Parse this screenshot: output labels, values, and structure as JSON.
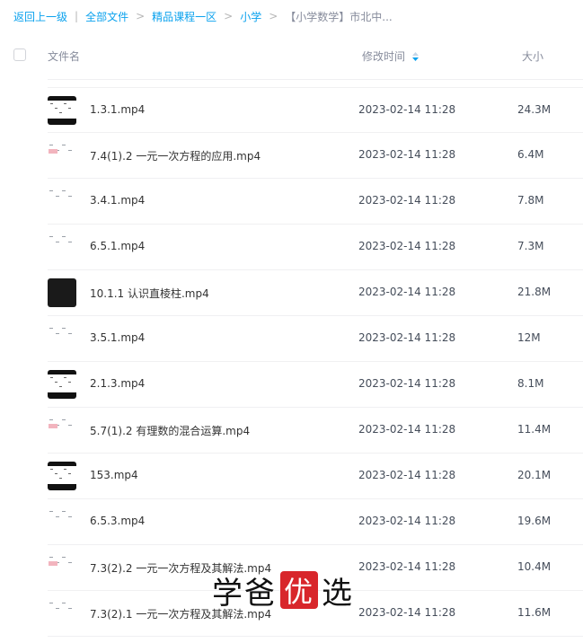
{
  "breadcrumb": {
    "back": "返回上一级",
    "items": [
      "全部文件",
      "精品课程一区",
      "小学"
    ],
    "current": "【小学数学】市北中..."
  },
  "header": {
    "name": "文件名",
    "time": "修改时间",
    "size": "大小"
  },
  "colors": {
    "link": "#0ba2ee",
    "muted": "#878c9c",
    "seal": "#d8262b"
  },
  "files": [
    {
      "name": "1.3.1.mp4",
      "time": "2023-02-14 11:28",
      "size": "24.3M",
      "thumb": "doc-dark"
    },
    {
      "name": "7.4(1).2 一元一次方程的应用.mp4",
      "time": "2023-02-14 11:28",
      "size": "6.4M",
      "thumb": "doc-pink"
    },
    {
      "name": "3.4.1.mp4",
      "time": "2023-02-14 11:28",
      "size": "7.8M",
      "thumb": "doc"
    },
    {
      "name": "6.5.1.mp4",
      "time": "2023-02-14 11:28",
      "size": "7.3M",
      "thumb": "doc"
    },
    {
      "name": "10.1.1 认识直棱柱.mp4",
      "time": "2023-02-14 11:28",
      "size": "21.8M",
      "thumb": "black"
    },
    {
      "name": "3.5.1.mp4",
      "time": "2023-02-14 11:28",
      "size": "12M",
      "thumb": "doc"
    },
    {
      "name": "2.1.3.mp4",
      "time": "2023-02-14 11:28",
      "size": "8.1M",
      "thumb": "doc-dark"
    },
    {
      "name": "5.7(1).2 有理数的混合运算.mp4",
      "time": "2023-02-14 11:28",
      "size": "11.4M",
      "thumb": "doc-pink"
    },
    {
      "name": "153.mp4",
      "time": "2023-02-14 11:28",
      "size": "20.1M",
      "thumb": "doc-dark"
    },
    {
      "name": "6.5.3.mp4",
      "time": "2023-02-14 11:28",
      "size": "19.6M",
      "thumb": "doc"
    },
    {
      "name": "7.3(2).2 一元一次方程及其解法.mp4",
      "time": "2023-02-14 11:28",
      "size": "10.4M",
      "thumb": "doc-pink"
    },
    {
      "name": "7.3(2).1 一元一次方程及其解法.mp4",
      "time": "2023-02-14 11:28",
      "size": "11.6M",
      "thumb": "doc"
    }
  ],
  "watermark": {
    "left": "学爸",
    "seal": "优",
    "right": "选"
  }
}
